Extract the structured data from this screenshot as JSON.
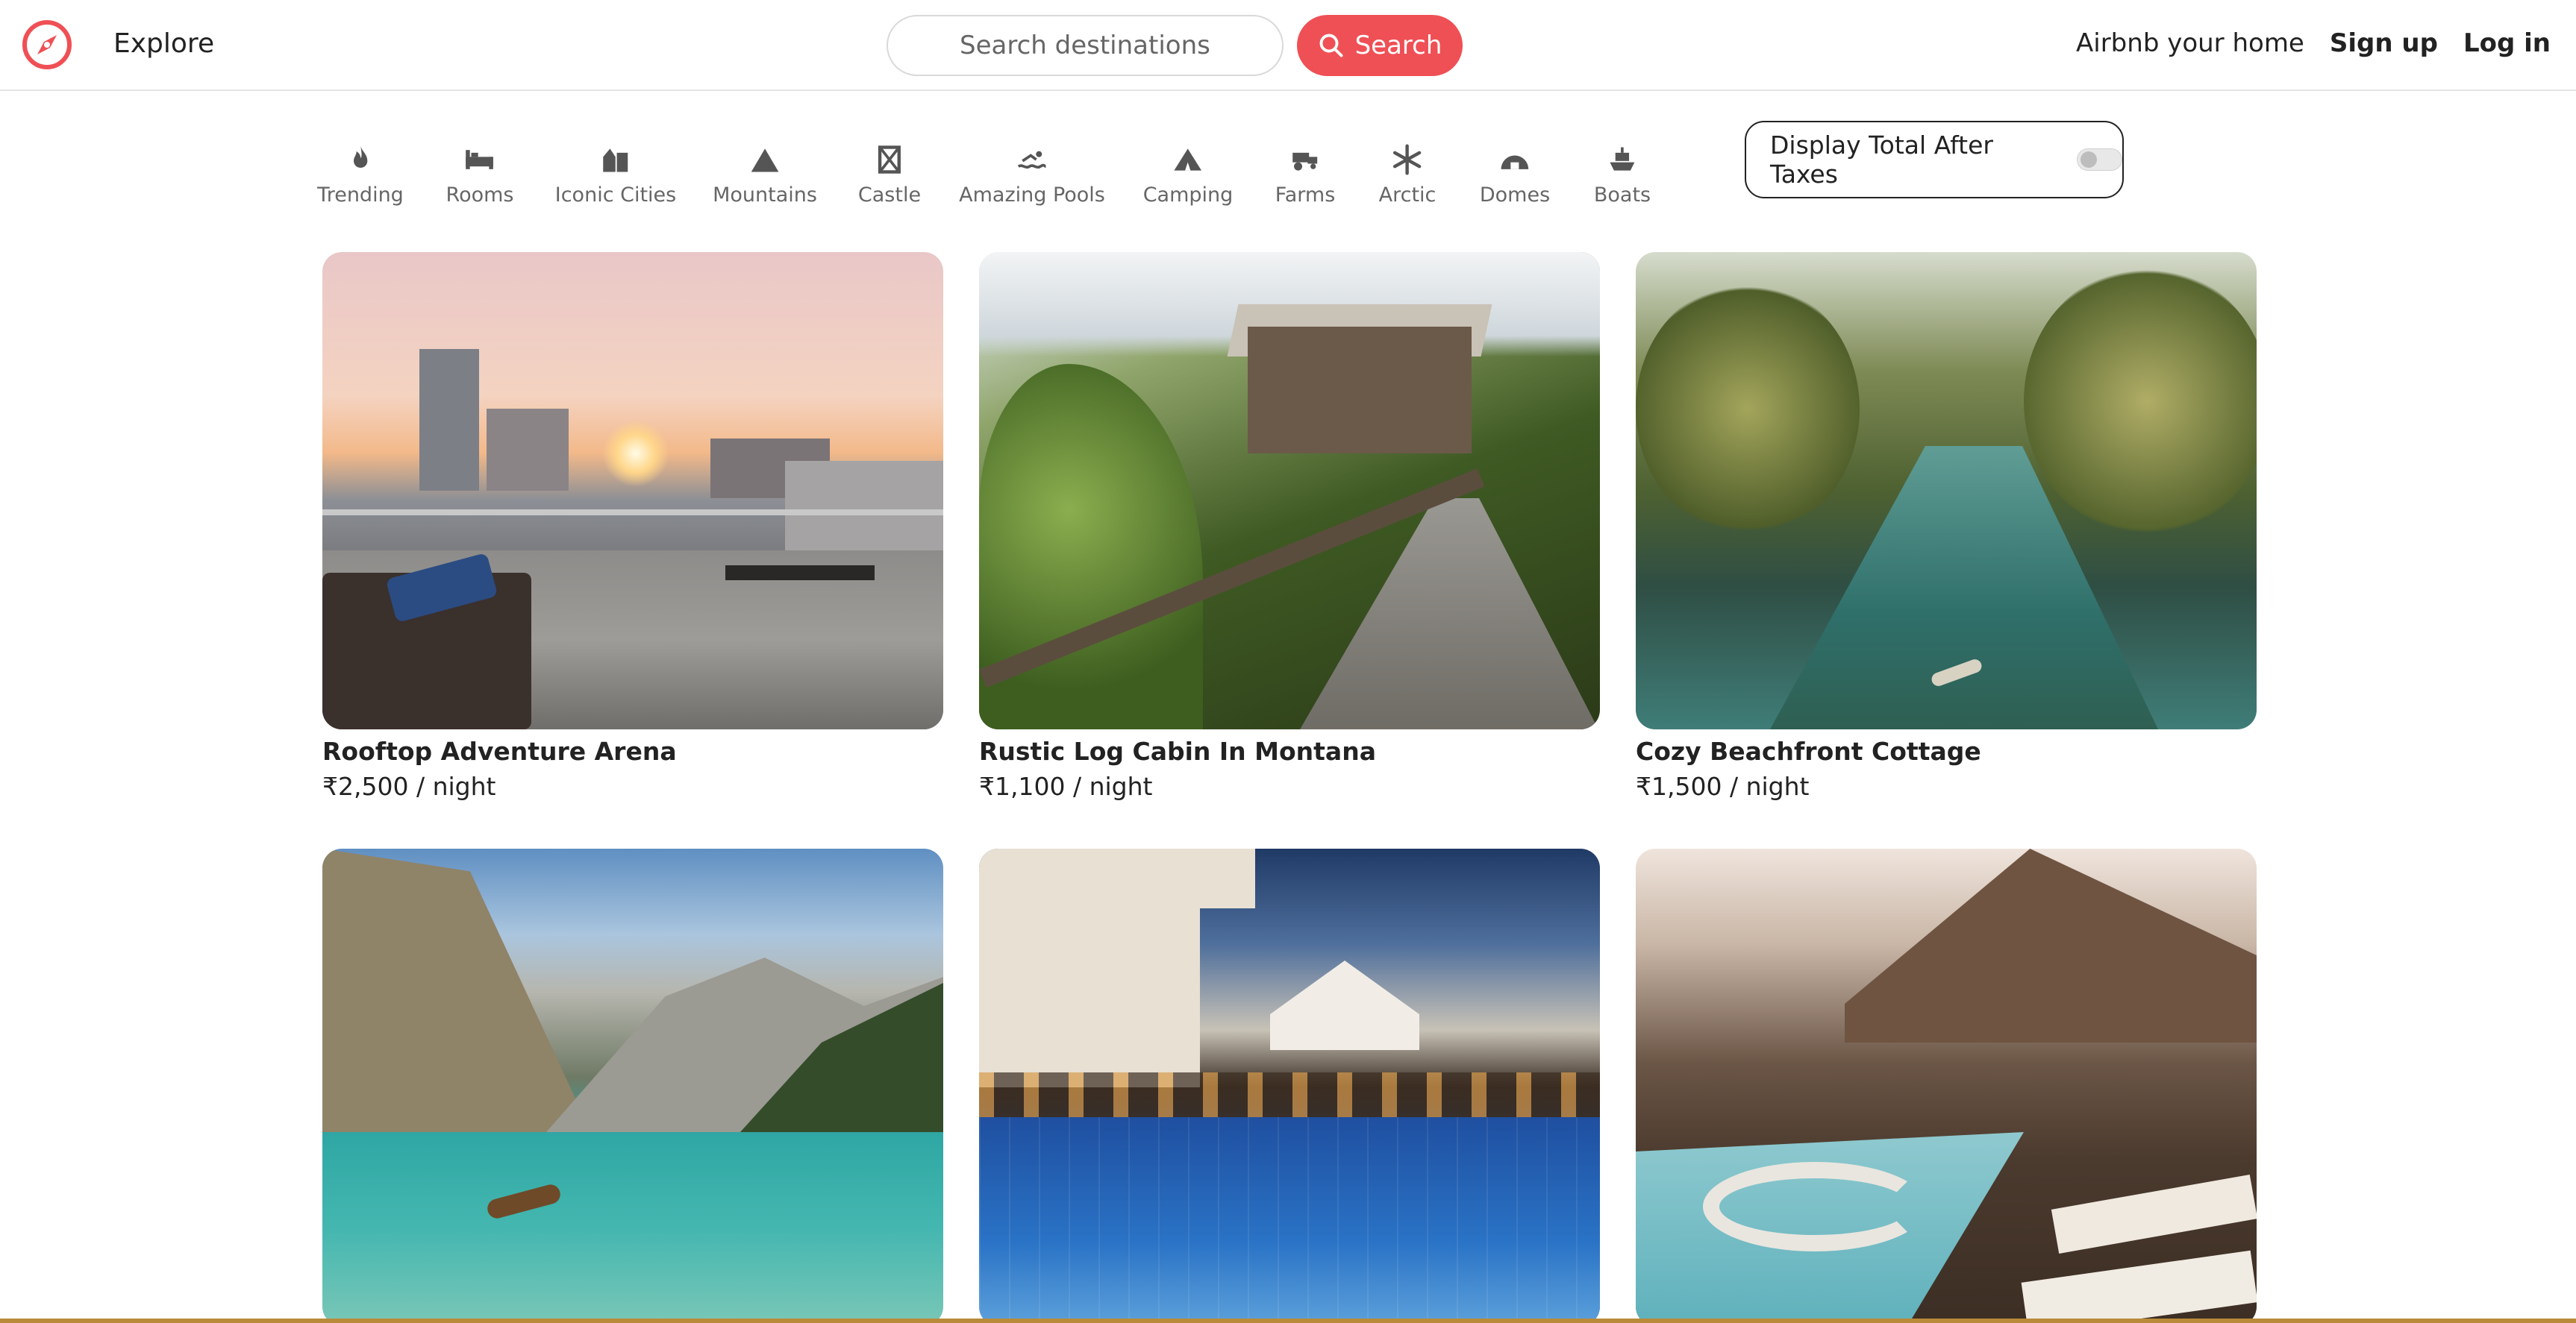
{
  "navbar": {
    "explore_label": "Explore",
    "search": {
      "placeholder": "Search destinations",
      "value": ""
    },
    "search_button_label": "Search",
    "host_link": "Airbnb your home",
    "signup_link": "Sign up",
    "login_link": "Log in",
    "accent_color": "#ef5055"
  },
  "categories": [
    {
      "label": "Trending",
      "icon": "flame-icon"
    },
    {
      "label": "Rooms",
      "icon": "bed-icon"
    },
    {
      "label": "Iconic Cities",
      "icon": "city-icon"
    },
    {
      "label": "Mountains",
      "icon": "mountain-icon"
    },
    {
      "label": "Castle",
      "icon": "castle-icon"
    },
    {
      "label": "Amazing Pools",
      "icon": "swimmer-icon"
    },
    {
      "label": "Camping",
      "icon": "tent-icon"
    },
    {
      "label": "Farms",
      "icon": "tractor-icon"
    },
    {
      "label": "Arctic",
      "icon": "snowflake-icon"
    },
    {
      "label": "Domes",
      "icon": "igloo-icon"
    },
    {
      "label": "Boats",
      "icon": "ship-icon"
    }
  ],
  "tax_toggle": {
    "label": "Display Total After Taxes",
    "checked": false
  },
  "listings": [
    {
      "title": "Rooftop Adventure Arena",
      "price": "₹2,500 / night"
    },
    {
      "title": "Rustic Log Cabin In Montana",
      "price": "₹1,100 / night"
    },
    {
      "title": "Cozy Beachfront Cottage",
      "price": "₹1,500 / night"
    },
    {
      "title": "",
      "price": ""
    },
    {
      "title": "",
      "price": ""
    },
    {
      "title": "",
      "price": ""
    }
  ]
}
